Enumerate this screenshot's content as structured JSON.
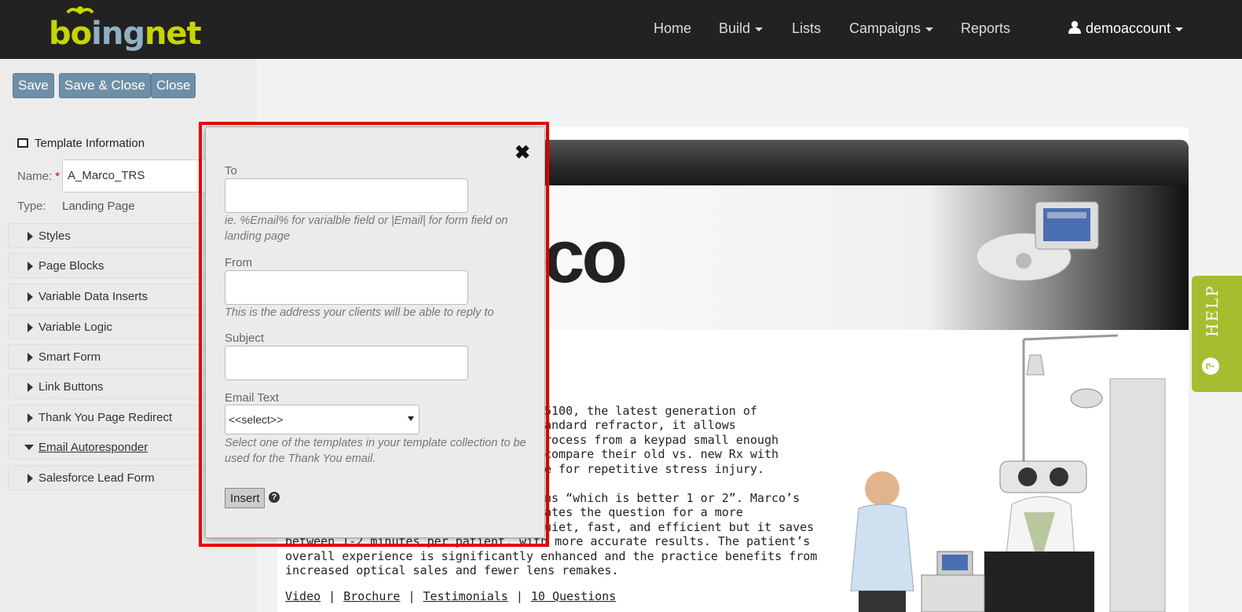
{
  "nav": {
    "logo_text": "boingnet",
    "items": [
      {
        "label": "Home",
        "dropdown": false
      },
      {
        "label": "Build",
        "dropdown": true
      },
      {
        "label": "Lists",
        "dropdown": false
      },
      {
        "label": "Campaigns",
        "dropdown": true
      },
      {
        "label": "Reports",
        "dropdown": false
      }
    ],
    "user": "demoaccount"
  },
  "toolbar": {
    "save_label": "Save",
    "save_close_label": "Save & Close",
    "close_label": "Close"
  },
  "template_info": {
    "heading": "Template Information",
    "name_label": "Name:",
    "required_mark": "*",
    "name_value": "A_Marco_TRS",
    "type_label": "Type:",
    "type_value": "Landing Page"
  },
  "accordion": [
    {
      "label": "Styles",
      "open": false
    },
    {
      "label": "Page Blocks",
      "open": false
    },
    {
      "label": "Variable Data Inserts",
      "open": false
    },
    {
      "label": "Variable Logic",
      "open": false
    },
    {
      "label": "Smart Form",
      "open": false
    },
    {
      "label": "Link Buttons",
      "open": false
    },
    {
      "label": "Thank You Page Redirect",
      "open": false
    },
    {
      "label": "Email Autoresponder",
      "open": true
    },
    {
      "label": "Salesforce Lead Form",
      "open": false
    }
  ],
  "modal": {
    "close_icon": "close-icon",
    "to_label": "To",
    "to_value": "",
    "to_hint": "ie. %Email% for varialble field or |Email| for form field on landing page",
    "from_label": "From",
    "from_value": "",
    "from_hint": "This is the address your clients will be able to reply to",
    "subject_label": "Subject",
    "subject_value": "",
    "email_text_label": "Email Text",
    "email_text_selected": "<<select>>",
    "email_text_hint": "Select one of the templates in your template collection to be used for the Thank You email.",
    "insert_label": "Insert",
    "help_icon": "question-circle-icon",
    "highlight_color": "#e00000"
  },
  "preview": {
    "brand_partial": "co",
    "lines": [
      "5100, the latest generation of",
      "andard refractor, it allows",
      "rocess from a keypad small enough",
      "compare their old vs. new Rx with",
      "e for repetitive stress injury.",
      "ns “which is better 1 or 2”.  Marco’s",
      "ates the question for a more",
      "uiet, fast, and efficient but it saves",
      "between 1-2 minutes per patient, with more accurate results. The patient’s",
      "overall experience is significantly enhanced and the practice benefits from",
      "increased optical sales and fewer lens remakes."
    ],
    "links": [
      "Video",
      "Brochure",
      "Testimonials",
      "10 Questions"
    ],
    "link_separator": "|"
  },
  "help_tab": {
    "label": "HELP",
    "icon_glyph": "?"
  },
  "colors": {
    "navbar": "#222222",
    "button_blue": "#6f8fa6",
    "help_green": "#a4be2f",
    "logo_green": "#c6d600"
  }
}
